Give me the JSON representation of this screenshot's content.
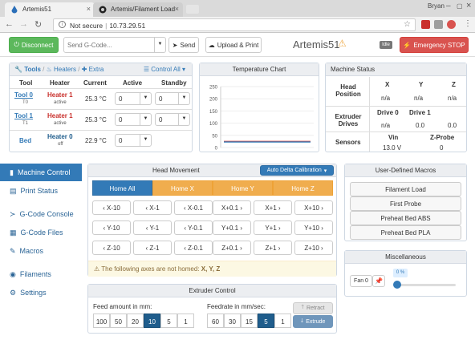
{
  "browser": {
    "tabs": [
      {
        "title": "Artemis51",
        "icon": "drop-icon"
      },
      {
        "title": "Artemis/Filament Load",
        "icon": "github-icon"
      }
    ],
    "profile": "Bryan",
    "security_label": "Not secure",
    "url": "10.73.29.51"
  },
  "header": {
    "disconnect_label": "Disconnect",
    "gcode_placeholder": "Send G-Code...",
    "send_label": "Send",
    "upload_label": "Upload & Print",
    "title": "Artemis51",
    "status_badge": "Idle",
    "estop_label": "Emergency STOP"
  },
  "tools_panel": {
    "tabs": [
      "Tools",
      "Heaters",
      "Extra"
    ],
    "control_all": "Control All",
    "columns": [
      "Tool",
      "Heater",
      "Current",
      "Active",
      "Standby"
    ],
    "rows": [
      {
        "tool": "Tool 0",
        "sub": "T0",
        "heater": "Heater 1",
        "state": "active",
        "current": "25.3 °C",
        "active": "0",
        "standby": "0"
      },
      {
        "tool": "Tool 1",
        "sub": "T1",
        "heater": "Heater 1",
        "state": "active",
        "current": "25.3 °C",
        "active": "0",
        "standby": "0"
      },
      {
        "tool": "Bed",
        "sub": "",
        "heater": "Heater 0",
        "state": "off",
        "current": "22.9 °C",
        "active": "0",
        "standby": ""
      }
    ]
  },
  "temp_chart": {
    "title": "Temperature Chart"
  },
  "chart_data": {
    "type": "line",
    "title": "Temperature Chart",
    "ylim": [
      0,
      250
    ],
    "yticks": [
      "250",
      "200",
      "150",
      "100",
      "50",
      "0"
    ],
    "series": [
      {
        "values": [
          25.3,
          25.3
        ],
        "color": "#d9534f"
      },
      {
        "values": [
          22.9,
          22.9
        ],
        "color": "#337ab7"
      }
    ]
  },
  "machine_status": {
    "title": "Machine Status",
    "axes": [
      "X",
      "Y",
      "Z"
    ],
    "head_position_label": "Head Position",
    "head_position": [
      "n/a",
      "n/a",
      "n/a"
    ],
    "extruder_label": "Extruder Drives",
    "drives": [
      "Drive 0",
      "Drive 1"
    ],
    "drive_values": [
      "n/a",
      "0.0",
      "0.0"
    ],
    "sensors_label": "Sensors",
    "sensor_names": [
      "Vin",
      "Z-Probe"
    ],
    "sensor_values": [
      "13.0 V",
      "0"
    ]
  },
  "sidebar": {
    "items": [
      {
        "label": "Machine Control",
        "icon": "joystick-icon"
      },
      {
        "label": "Print Status",
        "icon": "print-icon"
      },
      {
        "label": "G-Code Console",
        "icon": "console-icon"
      },
      {
        "label": "G-Code Files",
        "icon": "file-icon"
      },
      {
        "label": "Macros",
        "icon": "wrench-icon"
      },
      {
        "label": "Filaments",
        "icon": "circles-icon"
      },
      {
        "label": "Settings",
        "icon": "gear-icon"
      }
    ]
  },
  "head_movement": {
    "title": "Head Movement",
    "calibration": "Auto Delta Calibration",
    "home": [
      "Home All",
      "Home X",
      "Home Y",
      "Home Z"
    ],
    "rows": [
      [
        "X-10",
        "X-1",
        "X-0.1",
        "X+0.1",
        "X+1",
        "X+10"
      ],
      [
        "Y-10",
        "Y-1",
        "Y-0.1",
        "Y+0.1",
        "Y+1",
        "Y+10"
      ],
      [
        "Z-10",
        "Z-1",
        "Z-0.1",
        "Z+0.1",
        "Z+1",
        "Z+10"
      ]
    ],
    "warning_prefix": "The following axes are not homed:",
    "warning_axes": "X, Y, Z"
  },
  "extruder": {
    "title": "Extruder Control",
    "feed_label": "Feed amount in mm:",
    "feed_options": [
      "100",
      "50",
      "20",
      "10",
      "5",
      "1"
    ],
    "feed_selected": "10",
    "rate_label": "Feedrate in mm/sec:",
    "rate_options": [
      "60",
      "30",
      "15",
      "5",
      "1"
    ],
    "rate_selected": "5",
    "retract": "Retract",
    "extrude": "Extrude"
  },
  "macros": {
    "title": "User-Defined Macros",
    "items": [
      "Filament Load",
      "First Probe",
      "Preheat Bed ABS",
      "Preheat Bed PLA"
    ]
  },
  "misc": {
    "title": "Miscellaneous",
    "fan_label": "Fan 0",
    "fan_value": "0 %",
    "fan_level": 0
  }
}
